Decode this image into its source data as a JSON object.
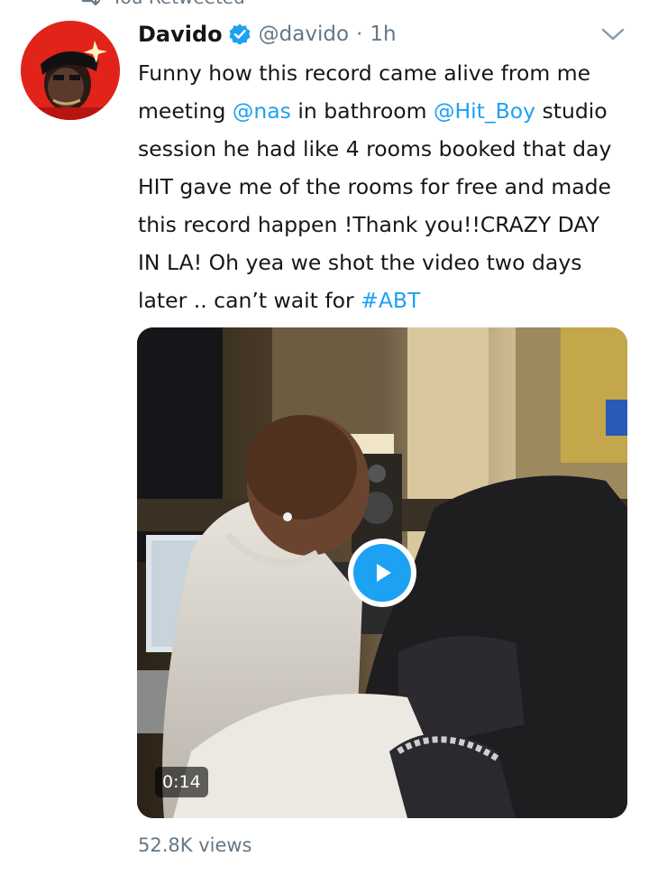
{
  "retweet_context": "You Retweeted",
  "tweet": {
    "display_name": "Davido",
    "handle": "@davido",
    "separator": "·",
    "time": "1h",
    "text_lines": [
      [
        {
          "t": "Funny how this record came alive from me"
        }
      ],
      [
        {
          "t": "meeting "
        },
        {
          "t": "@nas",
          "link": true
        },
        {
          "t": " in bathroom "
        },
        {
          "t": "@Hit_Boy",
          "link": true
        },
        {
          "t": " studio"
        }
      ],
      [
        {
          "t": "session he had like 4 rooms booked that day"
        }
      ],
      [
        {
          "t": "HIT gave me of the rooms for free and made"
        }
      ],
      [
        {
          "t": "this record happen !Thank you!!CRAZY DAY"
        }
      ],
      [
        {
          "t": "IN LA! Oh yea we shot the video two days"
        }
      ],
      [
        {
          "t": "later .. can’t wait for "
        },
        {
          "t": "#ABT",
          "link": true
        }
      ]
    ],
    "video_duration": "0:14",
    "views": "52.8K views"
  },
  "icons": {
    "retweet": "retweet-icon",
    "verified": "verified-badge-icon",
    "caret": "chevron-down-icon",
    "play": "play-icon",
    "avatar": "avatar-image"
  },
  "colors": {
    "link": "#1da1f2",
    "text": "#14171a",
    "secondary": "#657786",
    "verified": "#1da1f2",
    "avatar_bg": "#e2231a"
  }
}
